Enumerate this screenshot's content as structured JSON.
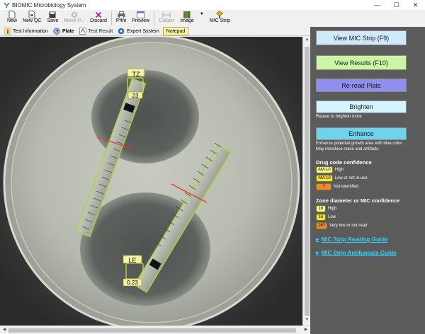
{
  "window": {
    "title": "BIOMIC Microbiology System",
    "minimize": "—",
    "maximize": "☐",
    "close": "✕"
  },
  "toolbar": [
    {
      "label": "New",
      "icon": "🗋",
      "enabled": true
    },
    {
      "label": "New QC",
      "icon": "🗋",
      "enabled": true
    },
    {
      "label": "Save",
      "icon": "💾",
      "enabled": true
    },
    {
      "label": "Move P...",
      "icon": "⊗",
      "enabled": false
    },
    {
      "label": "Discard",
      "icon": "✖",
      "enabled": true
    },
    {
      "label": "Print",
      "icon": "🖶",
      "enabled": true
    },
    {
      "label": "Preview",
      "icon": "🗔",
      "enabled": true
    },
    {
      "label": "Caliper",
      "icon": "⟂",
      "enabled": false
    },
    {
      "label": "Image",
      "icon": "▦",
      "enabled": true
    },
    {
      "label": "MIC Strip",
      "icon": "◆",
      "enabled": true
    }
  ],
  "tabs": [
    {
      "label": "Test Information",
      "icon": "ℹ"
    },
    {
      "label": "Plate",
      "icon": "◐"
    },
    {
      "label": "Test Result",
      "icon": "✎"
    },
    {
      "label": "Expert System",
      "icon": "⚙"
    },
    {
      "label": "Notepad",
      "icon": ""
    }
  ],
  "strips": {
    "top": {
      "code": "TZ",
      "value": "23"
    },
    "bottom": {
      "code": "LE",
      "value": "0.23"
    }
  },
  "panel": {
    "view_mic": "View MIC Strip (F9)",
    "view_results": "View Results (F10)",
    "reread": "Re-read Plate",
    "brighten": "Brighten",
    "brighten_note": "Repeat to brighten more",
    "enhance": "Enhance",
    "enhance_note_1": "Enhance potential growth area with blue color.",
    "enhance_note_2": "May introduce noise and artifacts.",
    "drug_head": "Drug code confidence",
    "drug_legend": [
      {
        "chip": "AM-10",
        "label": "High",
        "color": "#f7f79a"
      },
      {
        "chip": "AM-10",
        "label": "Low or not in-use",
        "color": "#f2e24a"
      },
      {
        "chip": "?",
        "label": "Not identified",
        "color": "#f08a2c"
      }
    ],
    "zone_head": "Zone diameter or MIC confidence",
    "zone_legend": [
      {
        "chip": "16",
        "label": "High",
        "color": "#f7f79a"
      },
      {
        "chip": "16",
        "label": "Low",
        "color": "#f2e24a"
      },
      {
        "chip": "16?",
        "label": "Very low or not read",
        "color": "#f08a2c"
      }
    ],
    "link_reading": "MIC Strip Reading Guide",
    "link_antifungal": "MIC Strip Antifungals Guide",
    "colors": {
      "view_mic": "#cfe9fb",
      "view_results": "#c9f7a4",
      "reread": "#8f8ff0",
      "brighten": "#d3f5ff",
      "enhance": "#6fd3ec",
      "link": "#2fd3ff"
    }
  }
}
